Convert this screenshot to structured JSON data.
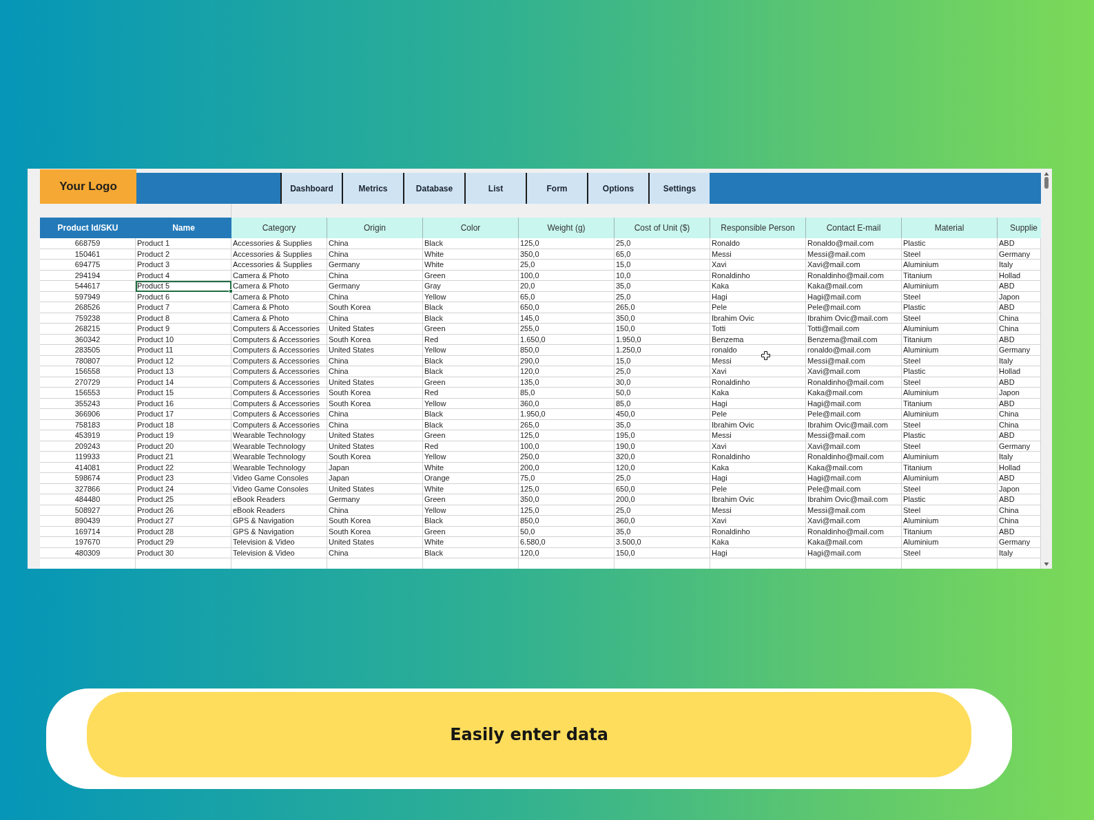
{
  "logo": {
    "text": "Your Logo"
  },
  "nav_tabs": [
    {
      "label": "Dashboard",
      "selected": false
    },
    {
      "label": "Metrics",
      "selected": false
    },
    {
      "label": "Database",
      "selected": false
    },
    {
      "label": "List",
      "selected": false
    },
    {
      "label": "Form",
      "selected": false
    },
    {
      "label": "Options",
      "selected": false
    },
    {
      "label": "Settings",
      "selected": false
    }
  ],
  "table": {
    "columns": [
      {
        "label": "Product Id/SKU",
        "kind": "key",
        "selected": false
      },
      {
        "label": "Name",
        "kind": "key",
        "selected": true
      },
      {
        "label": "Category",
        "kind": "detail",
        "selected": false
      },
      {
        "label": "Origin",
        "kind": "detail",
        "selected": false
      },
      {
        "label": "Color",
        "kind": "detail",
        "selected": false
      },
      {
        "label": "Weight (g)",
        "kind": "detail",
        "selected": false
      },
      {
        "label": "Cost of Unit ($)",
        "kind": "detail",
        "selected": false
      },
      {
        "label": "Responsible Person",
        "kind": "detail",
        "selected": false
      },
      {
        "label": "Contact E-mail",
        "kind": "detail",
        "selected": false
      },
      {
        "label": "Material",
        "kind": "detail",
        "selected": false
      },
      {
        "label": "Supplie",
        "kind": "detail",
        "selected": false
      }
    ],
    "rows": [
      {
        "selected": false,
        "cells": [
          "668759",
          "Product 1",
          "Accessories & Supplies",
          "China",
          "Black",
          "125,0",
          "25,0",
          "Ronaldo",
          "Ronaldo@mail.com",
          "Plastic",
          "ABD"
        ]
      },
      {
        "selected": false,
        "cells": [
          "150461",
          "Product 2",
          "Accessories & Supplies",
          "China",
          "White",
          "350,0",
          "65,0",
          "Messi",
          "Messi@mail.com",
          "Steel",
          "Germany"
        ]
      },
      {
        "selected": false,
        "cells": [
          "694775",
          "Product 3",
          "Accessories & Supplies",
          "Germany",
          "White",
          "25,0",
          "15,0",
          "Xavi",
          "Xavi@mail.com",
          "Aluminium",
          "Italy"
        ]
      },
      {
        "selected": false,
        "cells": [
          "294194",
          "Product 4",
          "Camera & Photo",
          "China",
          "Green",
          "100,0",
          "10,0",
          "Ronaldinho",
          "Ronaldinho@mail.com",
          "Titanium",
          "Hollad"
        ]
      },
      {
        "selected": true,
        "cells": [
          "544617",
          "Product 5",
          "Camera & Photo",
          "Germany",
          "Gray",
          "20,0",
          "35,0",
          "Kaka",
          "Kaka@mail.com",
          "Aluminium",
          "ABD"
        ]
      },
      {
        "selected": false,
        "cells": [
          "597949",
          "Product 6",
          "Camera & Photo",
          "China",
          "Yellow",
          "65,0",
          "25,0",
          "Hagi",
          "Hagi@mail.com",
          "Steel",
          "Japon"
        ]
      },
      {
        "selected": false,
        "cells": [
          "268526",
          "Product 7",
          "Camera & Photo",
          "South Korea",
          "Black",
          "650,0",
          "265,0",
          "Pele",
          "Pele@mail.com",
          "Plastic",
          "ABD"
        ]
      },
      {
        "selected": false,
        "cells": [
          "759238",
          "Product 8",
          "Camera & Photo",
          "China",
          "Black",
          "145,0",
          "350,0",
          "Ibrahim Ovic",
          "Ibrahim Ovic@mail.com",
          "Steel",
          "China"
        ]
      },
      {
        "selected": false,
        "cells": [
          "268215",
          "Product 9",
          "Computers & Accessories",
          "United States",
          "Green",
          "255,0",
          "150,0",
          "Totti",
          "Totti@mail.com",
          "Aluminium",
          "China"
        ]
      },
      {
        "selected": false,
        "cells": [
          "360342",
          "Product 10",
          "Computers & Accessories",
          "South Korea",
          "Red",
          "1.650,0",
          "1.950,0",
          "Benzema",
          "Benzema@mail.com",
          "Titanium",
          "ABD"
        ]
      },
      {
        "selected": false,
        "cells": [
          "283505",
          "Product 11",
          "Computers & Accessories",
          "United States",
          "Yellow",
          "850,0",
          "1.250,0",
          "ronaldo",
          "ronaldo@mail.com",
          "Aluminium",
          "Germany"
        ]
      },
      {
        "selected": false,
        "cells": [
          "780807",
          "Product 12",
          "Computers & Accessories",
          "China",
          "Black",
          "290,0",
          "15,0",
          "Messi",
          "Messi@mail.com",
          "Steel",
          "Italy"
        ]
      },
      {
        "selected": false,
        "cells": [
          "156558",
          "Product 13",
          "Computers & Accessories",
          "China",
          "Black",
          "120,0",
          "25,0",
          "Xavi",
          "Xavi@mail.com",
          "Plastic",
          "Hollad"
        ]
      },
      {
        "selected": false,
        "cells": [
          "270729",
          "Product 14",
          "Computers & Accessories",
          "United States",
          "Green",
          "135,0",
          "30,0",
          "Ronaldinho",
          "Ronaldinho@mail.com",
          "Steel",
          "ABD"
        ]
      },
      {
        "selected": false,
        "cells": [
          "156553",
          "Product 15",
          "Computers & Accessories",
          "South Korea",
          "Red",
          "85,0",
          "50,0",
          "Kaka",
          "Kaka@mail.com",
          "Aluminium",
          "Japon"
        ]
      },
      {
        "selected": false,
        "cells": [
          "355243",
          "Product 16",
          "Computers & Accessories",
          "South Korea",
          "Yellow",
          "360,0",
          "85,0",
          "Hagi",
          "Hagi@mail.com",
          "Titanium",
          "ABD"
        ]
      },
      {
        "selected": false,
        "cells": [
          "366906",
          "Product 17",
          "Computers & Accessories",
          "China",
          "Black",
          "1.950,0",
          "450,0",
          "Pele",
          "Pele@mail.com",
          "Aluminium",
          "China"
        ]
      },
      {
        "selected": false,
        "cells": [
          "758183",
          "Product 18",
          "Computers & Accessories",
          "China",
          "Black",
          "265,0",
          "35,0",
          "Ibrahim Ovic",
          "Ibrahim Ovic@mail.com",
          "Steel",
          "China"
        ]
      },
      {
        "selected": false,
        "cells": [
          "453919",
          "Product 19",
          "Wearable Technology",
          "United States",
          "Green",
          "125,0",
          "195,0",
          "Messi",
          "Messi@mail.com",
          "Plastic",
          "ABD"
        ]
      },
      {
        "selected": false,
        "cells": [
          "209243",
          "Product 20",
          "Wearable Technology",
          "United States",
          "Red",
          "100,0",
          "190,0",
          "Xavi",
          "Xavi@mail.com",
          "Steel",
          "Germany"
        ]
      },
      {
        "selected": false,
        "cells": [
          "119933",
          "Product 21",
          "Wearable Technology",
          "South Korea",
          "Yellow",
          "250,0",
          "320,0",
          "Ronaldinho",
          "Ronaldinho@mail.com",
          "Aluminium",
          "Italy"
        ]
      },
      {
        "selected": false,
        "cells": [
          "414081",
          "Product 22",
          "Wearable Technology",
          "Japan",
          "White",
          "200,0",
          "120,0",
          "Kaka",
          "Kaka@mail.com",
          "Titanium",
          "Hollad"
        ]
      },
      {
        "selected": false,
        "cells": [
          "598674",
          "Product 23",
          "Video Game Consoles",
          "Japan",
          "Orange",
          "75,0",
          "25,0",
          "Hagi",
          "Hagi@mail.com",
          "Aluminium",
          "ABD"
        ]
      },
      {
        "selected": false,
        "cells": [
          "327866",
          "Product 24",
          "Video Game Consoles",
          "United States",
          "White",
          "125,0",
          "650,0",
          "Pele",
          "Pele@mail.com",
          "Steel",
          "Japon"
        ]
      },
      {
        "selected": false,
        "cells": [
          "484480",
          "Product 25",
          "eBook Readers",
          "Germany",
          "Green",
          "350,0",
          "200,0",
          "Ibrahim Ovic",
          "Ibrahim Ovic@mail.com",
          "Plastic",
          "ABD"
        ]
      },
      {
        "selected": false,
        "cells": [
          "508927",
          "Product 26",
          "eBook Readers",
          "China",
          "Yellow",
          "125,0",
          "25,0",
          "Messi",
          "Messi@mail.com",
          "Steel",
          "China"
        ]
      },
      {
        "selected": false,
        "cells": [
          "890439",
          "Product 27",
          "GPS & Navigation",
          "South Korea",
          "Black",
          "850,0",
          "360,0",
          "Xavi",
          "Xavi@mail.com",
          "Aluminium",
          "China"
        ]
      },
      {
        "selected": false,
        "cells": [
          "169714",
          "Product 28",
          "GPS & Navigation",
          "South Korea",
          "Green",
          "50,0",
          "35,0",
          "Ronaldinho",
          "Ronaldinho@mail.com",
          "Titanium",
          "ABD"
        ]
      },
      {
        "selected": false,
        "cells": [
          "197670",
          "Product 29",
          "Television & Video",
          "United States",
          "White",
          "6.580,0",
          "3.500,0",
          "Kaka",
          "Kaka@mail.com",
          "Aluminium",
          "Germany"
        ]
      },
      {
        "selected": false,
        "cells": [
          "480309",
          "Product 30",
          "Television & Video",
          "China",
          "Black",
          "120,0",
          "150,0",
          "Hagi",
          "Hagi@mail.com",
          "Steel",
          "Italy"
        ]
      }
    ]
  },
  "caption": "Easily enter data"
}
